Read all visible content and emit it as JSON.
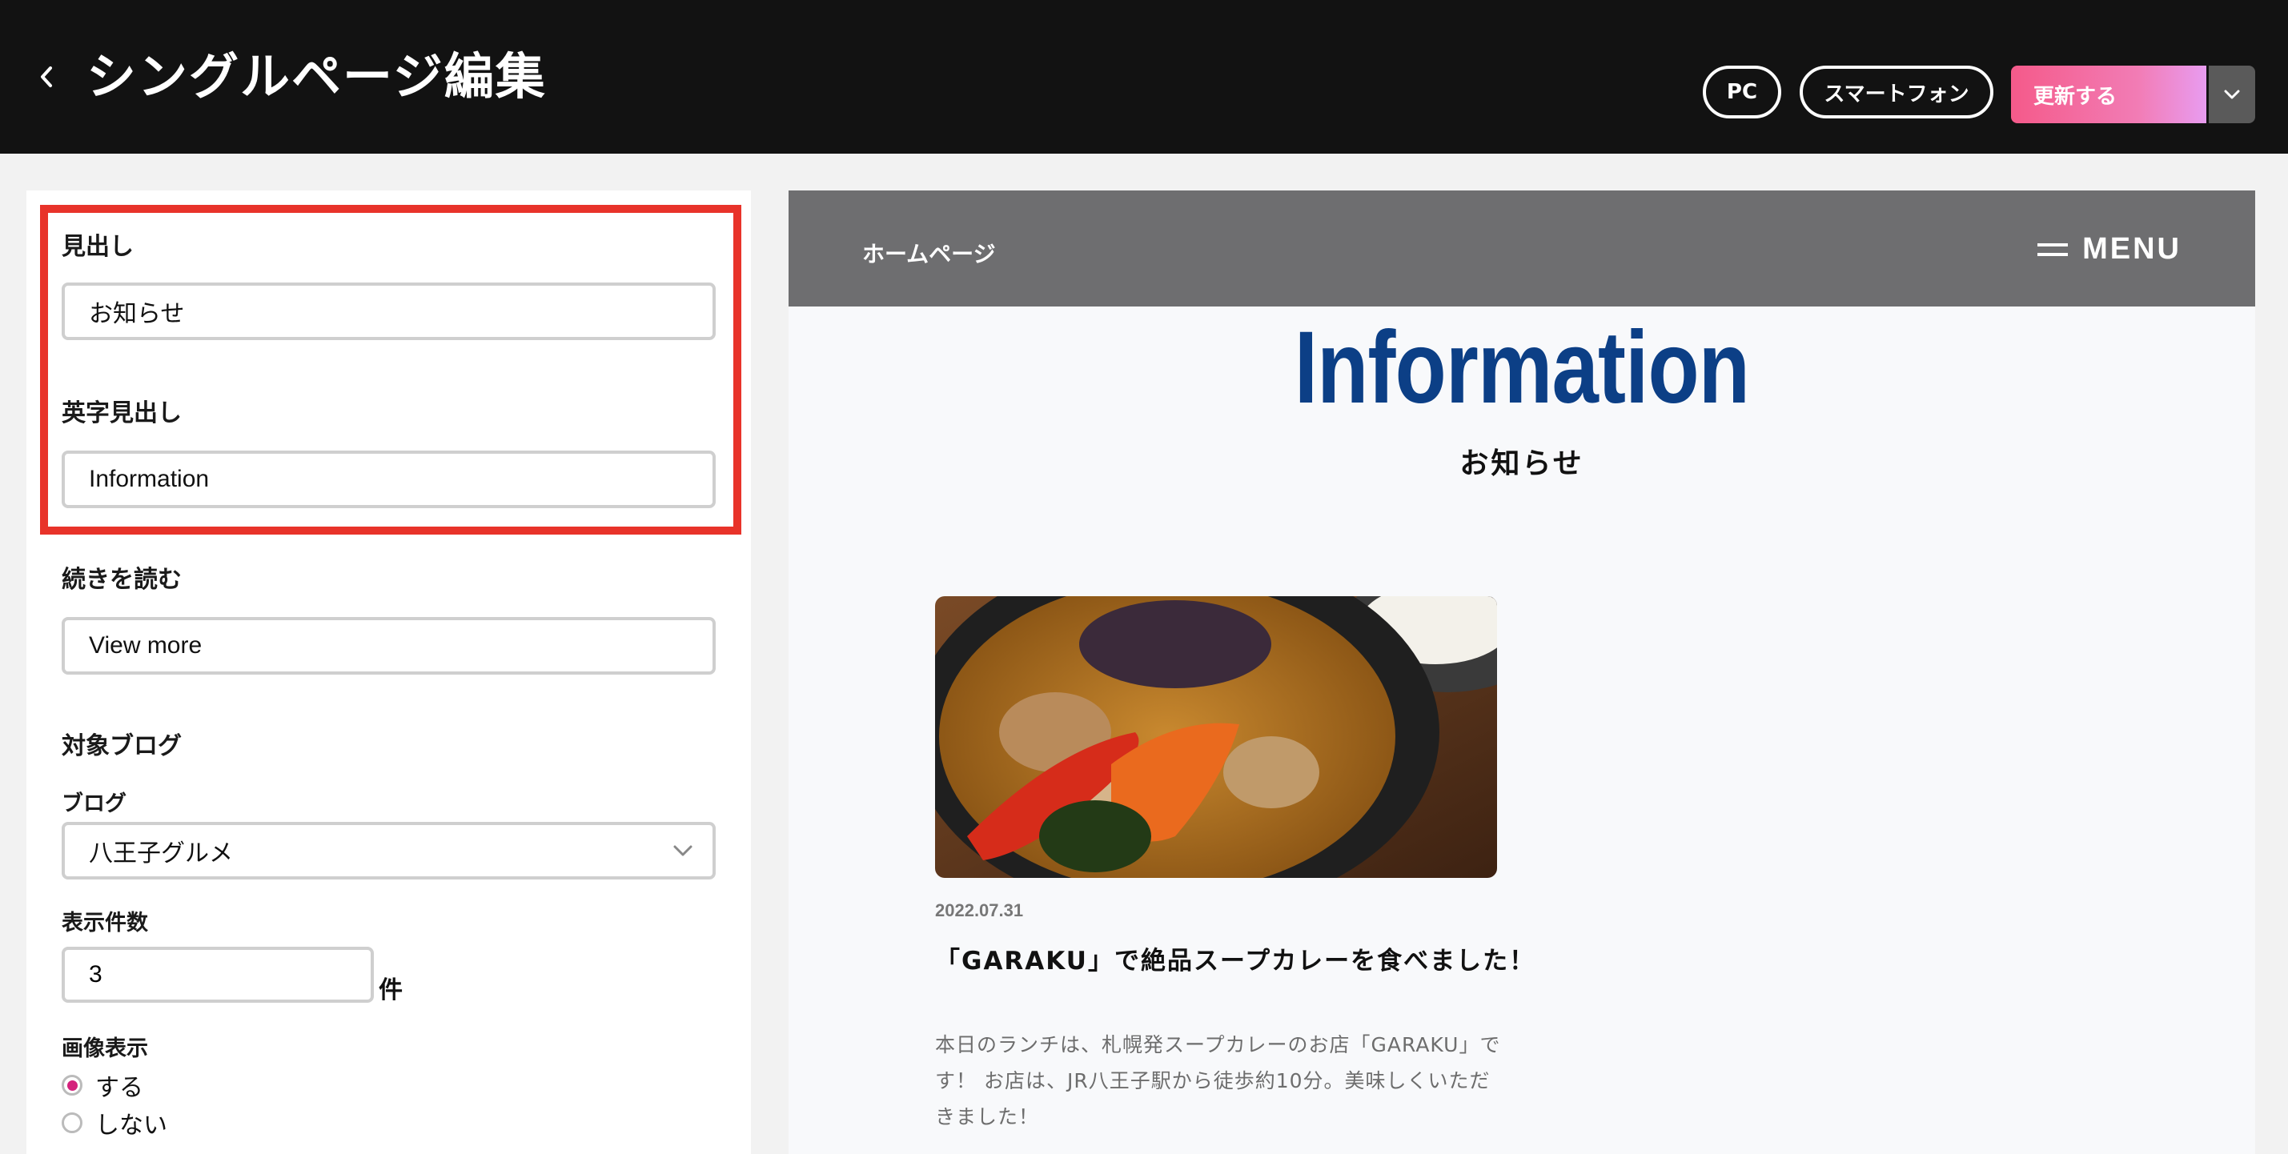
{
  "header": {
    "title": "シングルページ編集",
    "view_pc": "PC",
    "view_smartphone": "スマートフォン",
    "update_label": "更新する"
  },
  "settings": {
    "heading_label": "見出し",
    "heading_value": "お知らせ",
    "english_heading_label": "英字見出し",
    "english_heading_value": "Information",
    "read_more_label": "続きを読む",
    "read_more_value": "View more",
    "target_blog_label": "対象ブログ",
    "blog_label": "ブログ",
    "blog_selected": "八王子グルメ",
    "count_label": "表示件数",
    "count_value": "3",
    "count_unit": "件",
    "image_display_label": "画像表示",
    "image_display_options": [
      "する",
      "しない"
    ],
    "image_display_selected": "する"
  },
  "preview": {
    "home_label": "ホームページ",
    "menu_label": "MENU",
    "title_en": "Information",
    "title_ja": "お知らせ",
    "post": {
      "date": "2022.07.31",
      "title": "「GARAKU」で絶品スープカレーを食べました！",
      "excerpt": "本日のランチは、札幌発スープカレーのお店「GARAKU」です！ お店は、JR八王子駅から徒歩約10分。美味しくいただきました！"
    }
  },
  "colors": {
    "topbar_bg": "#121212",
    "highlight_border": "#e8332a",
    "preview_header_bg": "#6e6e70",
    "preview_title": "#0c3f86",
    "radio_selected": "#d4227c"
  },
  "icons": {
    "back": "chevron-left-icon",
    "dropdown": "chevron-down-icon",
    "menu": "hamburger-icon"
  }
}
